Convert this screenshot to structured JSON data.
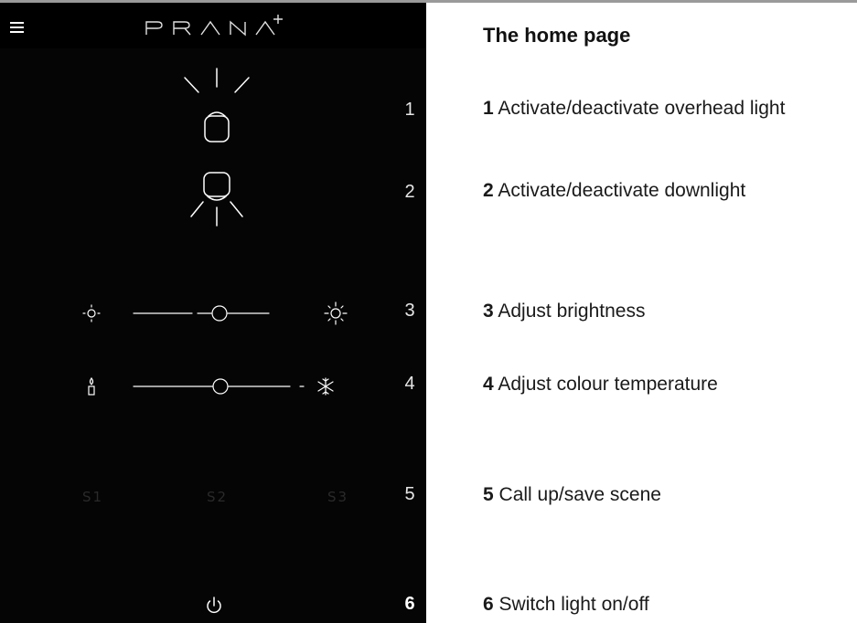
{
  "app": {
    "brand": "PRANA+"
  },
  "header": {
    "menu_icon": "hamburger-icon"
  },
  "controls": {
    "overhead_light": {
      "icon": "overhead-light-icon",
      "number": "1"
    },
    "downlight": {
      "icon": "downlight-icon",
      "number": "2"
    },
    "brightness": {
      "icon_low": "sun-low-icon",
      "icon_high": "sun-high-icon",
      "number": "3",
      "value": 0.55
    },
    "colour_temperature": {
      "icon_warm": "candle-icon",
      "icon_cold": "snowflake-icon",
      "number": "4",
      "value": 0.5
    },
    "scenes": {
      "items": [
        "S1",
        "S2",
        "S3"
      ],
      "number": "5"
    },
    "power": {
      "icon": "power-icon",
      "number": "6"
    }
  },
  "doc": {
    "heading": "The home page",
    "items": [
      {
        "num": "1",
        "text": "Activate/deactivate overhead light"
      },
      {
        "num": "2",
        "text": "Activate/deactivate downlight"
      },
      {
        "num": "3",
        "text": "Adjust brightness"
      },
      {
        "num": "4",
        "text": "Adjust colour temperature"
      },
      {
        "num": "5",
        "text": "Call up/save scene"
      },
      {
        "num": "6",
        "text": "Switch light on/off"
      }
    ]
  }
}
